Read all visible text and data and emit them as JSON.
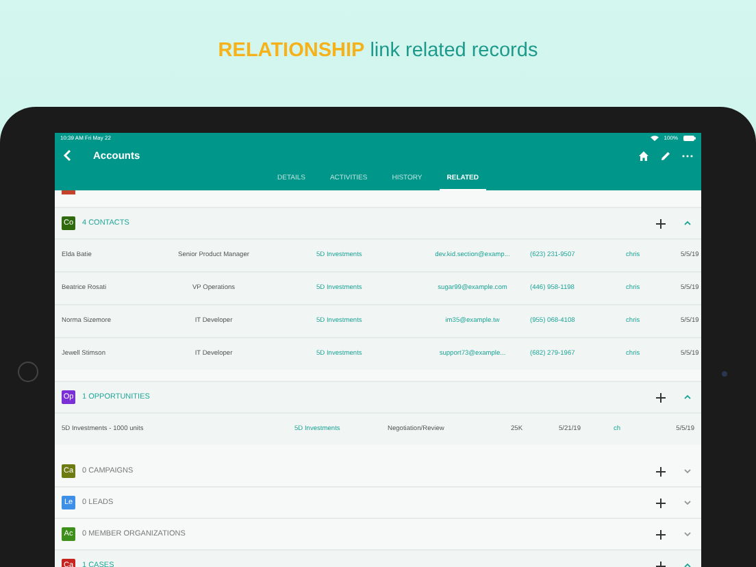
{
  "headline": "**RELATIONSHIP** link related records",
  "status_bar": {
    "time": "10:39 AM",
    "date": "Fri May 22",
    "battery": "100%"
  },
  "nav": {
    "title": "Accounts"
  },
  "tabs": [
    {
      "label": "DETAILS",
      "selected": false
    },
    {
      "label": "ACTIVITIES",
      "selected": false
    },
    {
      "label": "HISTORY",
      "selected": false
    },
    {
      "label": "RELATED",
      "selected": true
    }
  ],
  "sections": [
    {
      "icon": "Co",
      "color": "#2f6a0e",
      "title": "4 CONTACTS",
      "expanded": true,
      "kind": "contacts",
      "rows": [
        {
          "cells": [
            {
              "text": "Elda Batie",
              "link": false
            },
            {
              "text": "Senior Product Manager",
              "link": false
            },
            {
              "text": "5D Investments",
              "link": true
            },
            {
              "text": "dev.kid.section@examp...",
              "link": true
            },
            {
              "text": "(623) 231-9507",
              "link": true
            },
            {
              "text": "chris",
              "link": true
            },
            {
              "text": "5/5/19",
              "link": false
            }
          ]
        },
        {
          "cells": [
            {
              "text": "Beatrice Rosati",
              "link": false
            },
            {
              "text": "VP Operations",
              "link": false
            },
            {
              "text": "5D Investments",
              "link": true
            },
            {
              "text": "sugar99@example.com",
              "link": true
            },
            {
              "text": "(446) 958-1198",
              "link": true
            },
            {
              "text": "chris",
              "link": true
            },
            {
              "text": "5/5/19",
              "link": false
            }
          ]
        },
        {
          "cells": [
            {
              "text": "Norma Sizemore",
              "link": false
            },
            {
              "text": "IT Developer",
              "link": false
            },
            {
              "text": "5D Investments",
              "link": true
            },
            {
              "text": "im35@example.tw",
              "link": true
            },
            {
              "text": "(955) 068-4108",
              "link": true
            },
            {
              "text": "chris",
              "link": true
            },
            {
              "text": "5/5/19",
              "link": false
            }
          ]
        },
        {
          "cells": [
            {
              "text": "Jewell Stimson",
              "link": false
            },
            {
              "text": "IT Developer",
              "link": false
            },
            {
              "text": "5D Investments",
              "link": true
            },
            {
              "text": "support73@example...",
              "link": true
            },
            {
              "text": "(682) 279-1967",
              "link": true
            },
            {
              "text": "chris",
              "link": true
            },
            {
              "text": "5/5/19",
              "link": false
            }
          ]
        }
      ]
    },
    {
      "icon": "Op",
      "color": "#7b2fd6",
      "title": "1 OPPORTUNITIES",
      "expanded": true,
      "kind": "opportunities",
      "rows": [
        {
          "cells": [
            {
              "text": "5D Investments - 1000 units",
              "link": false
            },
            {
              "text": "5D Investments",
              "link": true
            },
            {
              "text": "Negotiation/Review",
              "link": false
            },
            {
              "text": "25K",
              "link": false
            },
            {
              "text": "5/21/19",
              "link": false
            },
            {
              "text": "ch",
              "link": true
            },
            {
              "text": "5/5/19",
              "link": false
            }
          ]
        }
      ]
    },
    {
      "icon": "Ca",
      "color": "#6e7a12",
      "title": "0 CAMPAIGNS",
      "expanded": false,
      "kind": "empty"
    },
    {
      "icon": "Le",
      "color": "#3d8fe8",
      "title": "0 LEADS",
      "expanded": false,
      "kind": "empty"
    },
    {
      "icon": "Ac",
      "color": "#3f8f1c",
      "title": "0 MEMBER ORGANIZATIONS",
      "expanded": false,
      "kind": "empty"
    },
    {
      "icon": "Ca",
      "color": "#c8241f",
      "title": "1 CASES",
      "expanded": true,
      "kind": "empty"
    }
  ]
}
